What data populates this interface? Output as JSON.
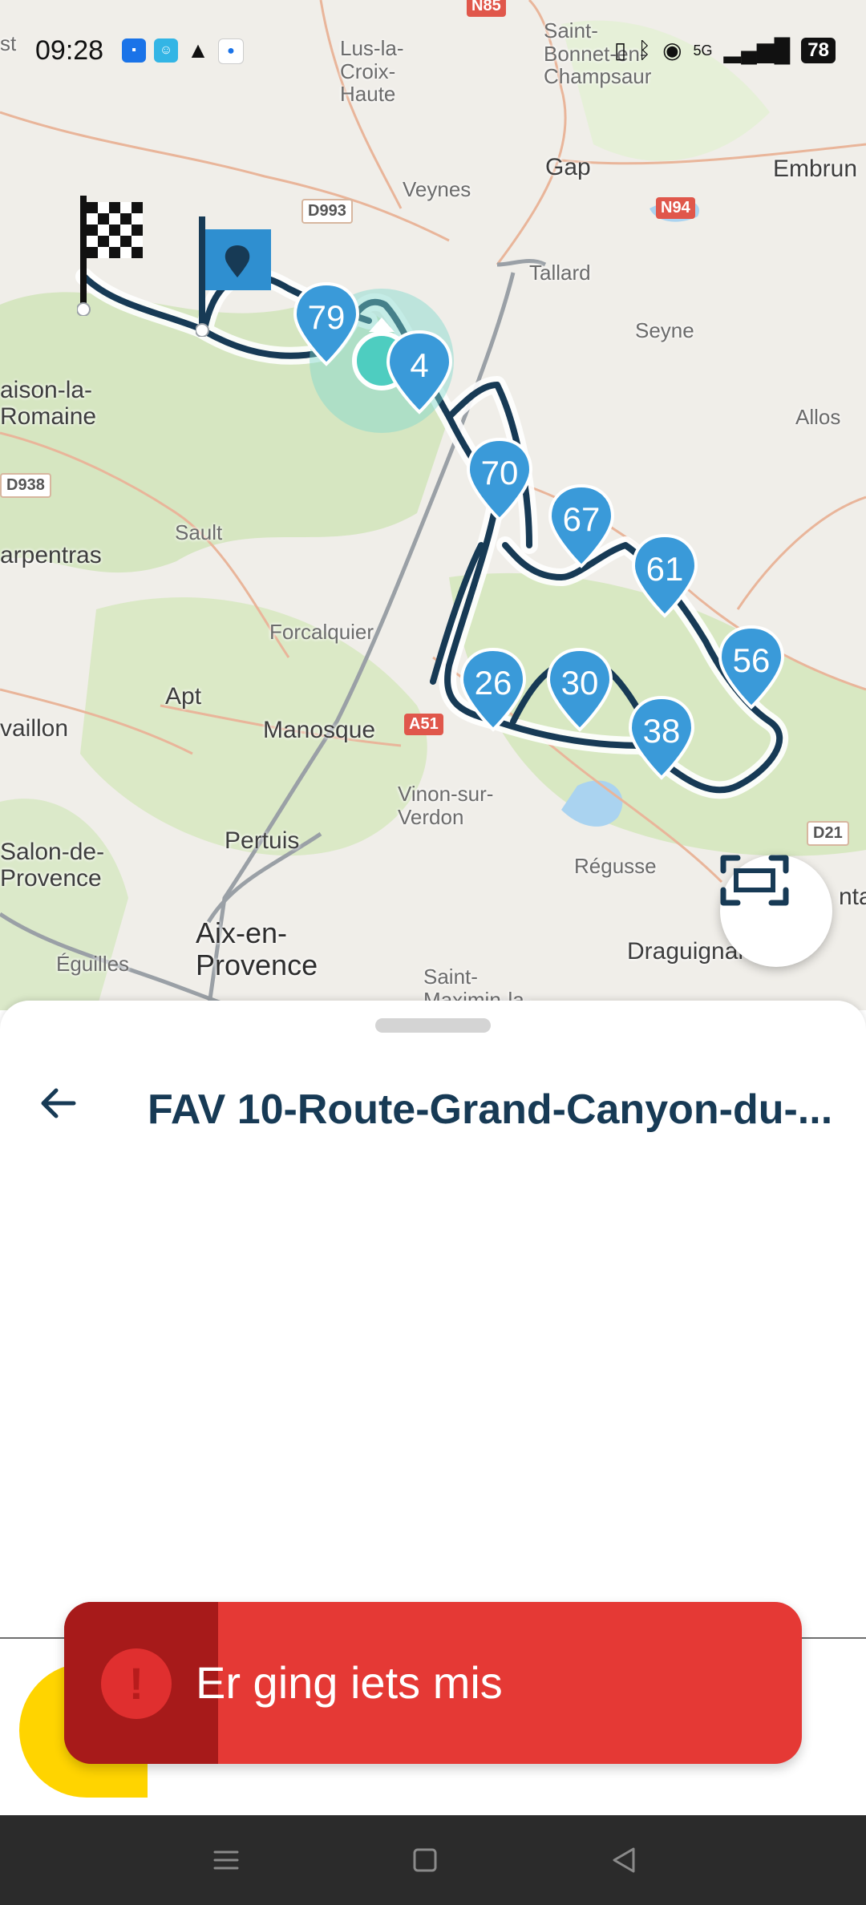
{
  "status_bar": {
    "time": "09:28",
    "battery": "78",
    "network": "5G"
  },
  "map": {
    "places": {
      "lus": "Lus-la-\nCroix-\nHaute",
      "saint_bonnet": "Saint-\nBonnet-en-\nChampsaur",
      "gap": "Gap",
      "embrun": "Embrun",
      "veynes": "Veynes",
      "tallard": "Tallard",
      "seyne": "Seyne",
      "vaison": "aison-la-\nRomaine",
      "allos": "Allos",
      "sault": "Sault",
      "carpentras": "arpentras",
      "forcalquier": "Forcalquier",
      "apt": "Apt",
      "cavaillon": "vaillon",
      "manosque": "Manosque",
      "vinon": "Vinon-sur-\nVerdon",
      "pertuis": "Pertuis",
      "salon": "Salon-de-\nProvence",
      "aix": "Aix-en-\nProvence",
      "eguilles": "Éguilles",
      "regusse": "Régusse",
      "draguignan": "Draguignan",
      "saint_maximin": "Saint-\nMaximin-la-",
      "st": "st",
      "nta": "nta"
    },
    "roads": {
      "n85": "N85",
      "d993": "D993",
      "n94": "N94",
      "d938": "D938",
      "a51": "A51",
      "d21": "D21"
    },
    "pins": [
      {
        "label": "79"
      },
      {
        "label": "4"
      },
      {
        "label": "70"
      },
      {
        "label": "67"
      },
      {
        "label": "61"
      },
      {
        "label": "56"
      },
      {
        "label": "26"
      },
      {
        "label": "30"
      },
      {
        "label": "38"
      }
    ]
  },
  "sheet": {
    "title": "FAV 10-Route-Grand-Canyon-du-..."
  },
  "toast": {
    "icon": "!",
    "message": "Er ging iets mis"
  },
  "colors": {
    "title": "#173a55",
    "toast": "#e53935",
    "toast_dark": "#a71a1a",
    "pin": "#3a9ad9",
    "route": "#173a55"
  }
}
